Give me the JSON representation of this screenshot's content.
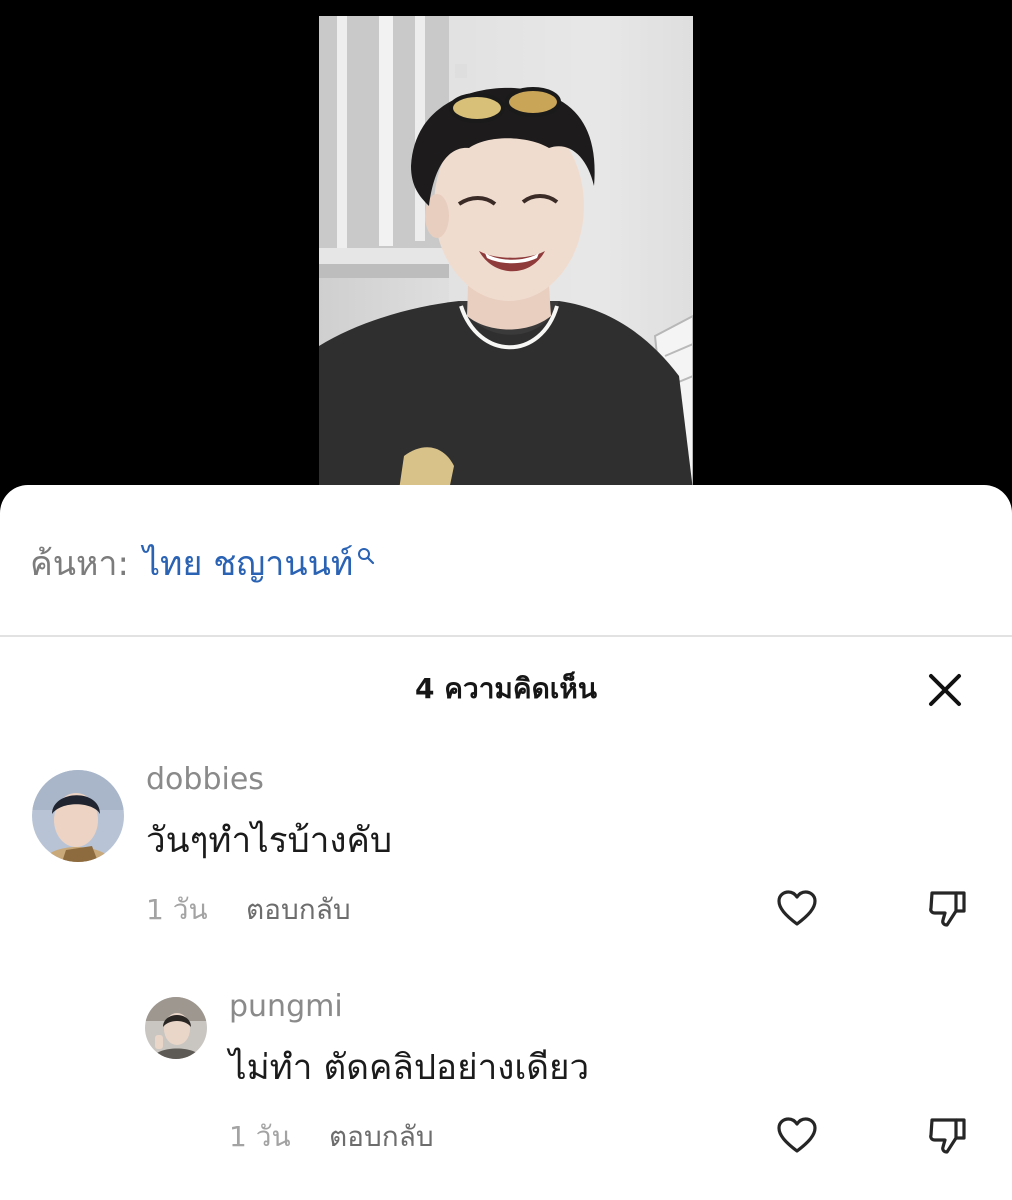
{
  "search": {
    "prefix": "ค้นหา:",
    "term": "ไทย ชญานนท์"
  },
  "comments_panel": {
    "title": "4 ความคิดเห็น"
  },
  "comments": [
    {
      "username": "dobbies",
      "text": "วันๆทำไรบ้างคับ",
      "time": "1 วัน",
      "reply_label": "ตอบกลับ"
    },
    {
      "username": "pungmi",
      "text": "ไม่ทำ ตัดคลิปอย่างเดียว",
      "time": "1 วัน",
      "reply_label": "ตอบกลับ"
    }
  ],
  "icons": {
    "search": "search-icon",
    "close": "close-icon",
    "like": "heart-icon",
    "dislike": "thumbs-down-icon"
  },
  "colors": {
    "search_term": "#2a62b4",
    "background": "#000000",
    "sheet": "#ffffff"
  }
}
